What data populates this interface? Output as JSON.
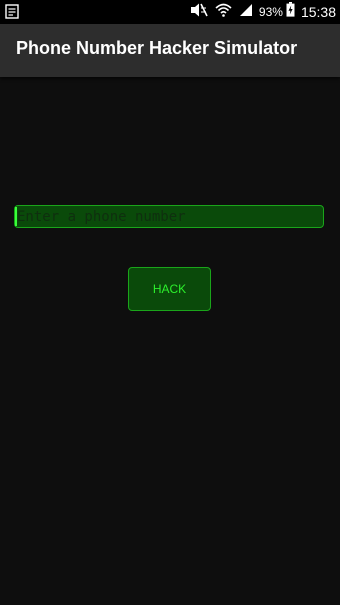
{
  "status_bar": {
    "notification_icon": "notes-icon",
    "mute_icon": "mute-icon",
    "wifi_icon": "wifi-icon",
    "signal_icon": "signal-icon",
    "battery_icon": "battery-charging-icon",
    "battery_percent": "93%",
    "time": "15:38"
  },
  "action_bar": {
    "title": "Phone Number Hacker Simulator"
  },
  "form": {
    "phone_placeholder": "Enter a phone number",
    "phone_value": "",
    "hack_label": "HACK"
  },
  "colors": {
    "background": "#0e0e0e",
    "action_bar": "#2d2d2d",
    "accent_green": "#2cf02c",
    "field_fill": "#0a4a0a",
    "field_border": "#1aa51a"
  }
}
